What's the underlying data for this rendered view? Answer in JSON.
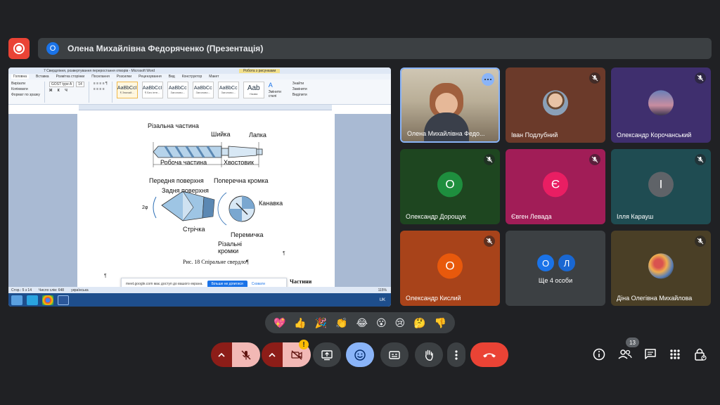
{
  "presenter": {
    "initial": "О",
    "title": "Олена Михайлівна Федоряченко (Презентація)"
  },
  "shared_screen": {
    "window_title": "7 Свердління, розвертування переростання отворів - Microsoft Word",
    "context_tab": "Робота з рисунками",
    "tabs": [
      "Головна",
      "Вставка",
      "Розмітка сторінки",
      "Посилання",
      "Розсилки",
      "Рецензування",
      "Вид",
      "Конструктор",
      "Макет"
    ],
    "clipboard": [
      "Вирізати",
      "Копіювати",
      "Формат по зразку"
    ],
    "font_name": "GOST type A",
    "font_size": "14",
    "styles": [
      {
        "sample": "AaBbCcI",
        "name": "¶ Звичай..."
      },
      {
        "sample": "AaBbCcI",
        "name": "¶ Без інте..."
      },
      {
        "sample": "AaBbCc",
        "name": "Заголово..."
      },
      {
        "sample": "AaBbCc",
        "name": "Заголово..."
      },
      {
        "sample": "AaBbCc",
        "name": "Заголово..."
      },
      {
        "sample": "Aab",
        "name": "Назва"
      }
    ],
    "change_styles": "Змінити стилі",
    "editing": [
      "Знайти",
      "Замінити",
      "Виділити"
    ],
    "figure_labels": {
      "cutting_part": "Різальна частина",
      "neck": "Шийка",
      "tang": "Лапка",
      "working_part": "Робоча частина",
      "shank": "Хвостовик",
      "front_surface": "Передня поверхня",
      "back_surface": "Задня поверхня",
      "cross_edge": "Поперечна кромка",
      "angle": "2φ",
      "groove": "Канавка",
      "land": "Стрічка",
      "web": "Перемичка",
      "cutting_edges": "Різальні кромки"
    },
    "caption": "Рис. 18 Спіральне свердло¶",
    "side_text": "Частини",
    "notification": {
      "text": "meet.google.com має доступ до вашого екрана.",
      "button": "Більше не ділитися",
      "link": "Сховати"
    },
    "status": {
      "page": "Стор.: 5 з 14",
      "words": "Число слів: 648",
      "lang": "українська",
      "zoom": "115%"
    },
    "taskbar_time": "UK"
  },
  "participants": [
    {
      "name": "Олена Михайлівна Федо...",
      "type": "video",
      "bg": "#3c4043",
      "muted": false,
      "options": true
    },
    {
      "name": "Іван Подлубний",
      "type": "photo",
      "bg": "#6b3a2a",
      "muted": true
    },
    {
      "name": "Олександр Корочанський",
      "type": "photo",
      "bg": "#3f2f6e",
      "muted": true
    },
    {
      "name": "Олександр Дорощук",
      "type": "initial",
      "initial": "О",
      "bg": "#1e4620",
      "avatar": "#1e8e3e",
      "muted": true
    },
    {
      "name": "Євген Левада",
      "type": "initial",
      "initial": "Є",
      "bg": "#a11d57",
      "avatar": "#e91e63",
      "muted": true
    },
    {
      "name": "Ілля Карауш",
      "type": "initial",
      "initial": "І",
      "bg": "#1f4c52",
      "avatar": "#5f6368",
      "muted": true
    },
    {
      "name": "Олександр Кислий",
      "type": "initial",
      "initial": "О",
      "bg": "#a8431a",
      "avatar": "#e8590c",
      "muted": true
    },
    {
      "name": "Ще 4 особи",
      "type": "group",
      "initials": [
        "О",
        "Л"
      ],
      "bg": "#3c4043",
      "muted": false
    },
    {
      "name": "Діна Олегівна Михайлова",
      "type": "photo",
      "bg": "#4a3f26",
      "muted": true
    }
  ],
  "reactions": [
    "💖",
    "👍",
    "🎉",
    "👏",
    "😂",
    "😮",
    "😢",
    "🤔",
    "👎"
  ],
  "controls": {
    "warning": "!",
    "people_count": "13"
  },
  "colors": {
    "background": "#202124",
    "surface": "#3c4043",
    "danger": "#ea4335",
    "accent": "#8ab4f8"
  }
}
